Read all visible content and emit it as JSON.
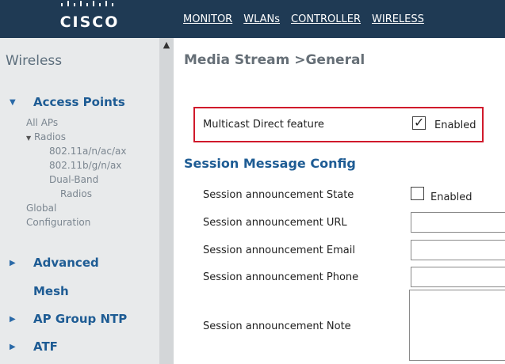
{
  "header": {
    "logo_text": "CISCO",
    "nav": [
      "MONITOR",
      "WLANs",
      "CONTROLLER",
      "WIRELESS"
    ]
  },
  "sidebar": {
    "title": "Wireless",
    "access_points": {
      "label": "Access Points",
      "all_aps": "All APs",
      "radios": {
        "label": "Radios",
        "items": [
          "802.11a/n/ac/ax",
          "802.11b/g/n/ax",
          "Dual-Band",
          "Radios"
        ]
      },
      "global_config_1": "Global",
      "global_config_2": "Configuration"
    },
    "sections": [
      "Advanced",
      "Mesh",
      "AP Group NTP",
      "ATF"
    ]
  },
  "main": {
    "page_title": "Media Stream >General",
    "multicast": {
      "label": "Multicast Direct feature",
      "checked": true,
      "enabled_label": "Enabled"
    },
    "session_heading": "Session Message Config",
    "session": {
      "state_label": "Session announcement State",
      "state_checked": false,
      "state_enabled_label": "Enabled",
      "url_label": "Session announcement URL",
      "url_value": "",
      "email_label": "Session announcement Email",
      "email_value": "",
      "phone_label": "Session announcement Phone",
      "phone_value": "",
      "note_label": "Session announcement Note",
      "note_value": ""
    }
  },
  "colors": {
    "topbar": "#1f3a54",
    "sidebar": "#e8eaeb",
    "accent_blue": "#1e5c94",
    "highlight_red": "#d0192b"
  }
}
